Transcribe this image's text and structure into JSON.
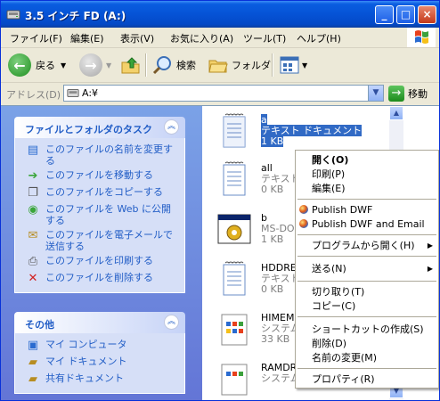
{
  "window": {
    "title": "3.5 インチ FD (A:)",
    "controls": [
      "_",
      "□",
      "×"
    ]
  },
  "menu": [
    "ファイル(F)",
    "編集(E)",
    "表示(V)",
    "お気に入り(A)",
    "ツール(T)",
    "ヘルプ(H)"
  ],
  "toolbar": {
    "back": "戻る",
    "search": "検索",
    "folders": "フォルダ"
  },
  "address": {
    "label": "アドレス(D)",
    "value": "A:¥",
    "go": "移動"
  },
  "tasks": {
    "title": "ファイルとフォルダのタスク",
    "items": [
      {
        "label": "このファイルの名前を変更する",
        "icon": "rename-icon"
      },
      {
        "label": "このファイルを移動する",
        "icon": "move-icon"
      },
      {
        "label": "このファイルをコピーする",
        "icon": "copy-icon"
      },
      {
        "label": "このファイルを Web に公開する",
        "icon": "web-publish-icon"
      },
      {
        "label": "このファイルを電子メールで送信する",
        "icon": "email-icon"
      },
      {
        "label": "このファイルを印刷する",
        "icon": "print-icon"
      },
      {
        "label": "このファイルを削除する",
        "icon": "delete-icon"
      }
    ]
  },
  "other": {
    "title": "その他",
    "items": [
      {
        "label": "マイ コンピュータ",
        "icon": "my-computer-icon"
      },
      {
        "label": "マイ ドキュメント",
        "icon": "my-documents-icon"
      },
      {
        "label": "共有ドキュメント",
        "icon": "shared-documents-icon"
      }
    ]
  },
  "files": [
    {
      "name": "a",
      "type": "テキスト ドキュメント",
      "size": "1 KB",
      "icon": "text-document-icon",
      "selected": true
    },
    {
      "name": "all",
      "type": "テキスト",
      "size": "0 KB",
      "icon": "text-document-icon"
    },
    {
      "name": "b",
      "type": "MS-DO",
      "size": "1 KB",
      "icon": "ms-dos-program-icon"
    },
    {
      "name": "HDDRE",
      "type": "テキスト",
      "size": "0 KB",
      "icon": "text-document-icon"
    },
    {
      "name": "HIMEM",
      "type": "システム",
      "size": "33 KB",
      "icon": "system-file-icon"
    },
    {
      "name": "RAMDR",
      "type": "システム",
      "size": "",
      "icon": "system-file-icon"
    }
  ],
  "context_menu": [
    {
      "label": "開く(O)",
      "bold": true
    },
    {
      "label": "印刷(P)"
    },
    {
      "label": "編集(E)"
    },
    {
      "sep": true
    },
    {
      "label": "Publish DWF",
      "icon": "dwf-icon"
    },
    {
      "label": "Publish DWF and Email",
      "icon": "dwf-icon"
    },
    {
      "sep": true
    },
    {
      "label": "プログラムから開く(H)",
      "submenu": true
    },
    {
      "sep": true
    },
    {
      "label": "送る(N)",
      "submenu": true
    },
    {
      "sep": true
    },
    {
      "label": "切り取り(T)"
    },
    {
      "label": "コピー(C)"
    },
    {
      "sep": true
    },
    {
      "label": "ショートカットの作成(S)"
    },
    {
      "label": "削除(D)"
    },
    {
      "label": "名前の変更(M)"
    },
    {
      "sep": true
    },
    {
      "label": "プロパティ(R)"
    }
  ],
  "colors": {
    "titlebar": "#0553d6",
    "taskpane": "#6f8fde",
    "link": "#215dc6",
    "selection": "#316ac5"
  }
}
